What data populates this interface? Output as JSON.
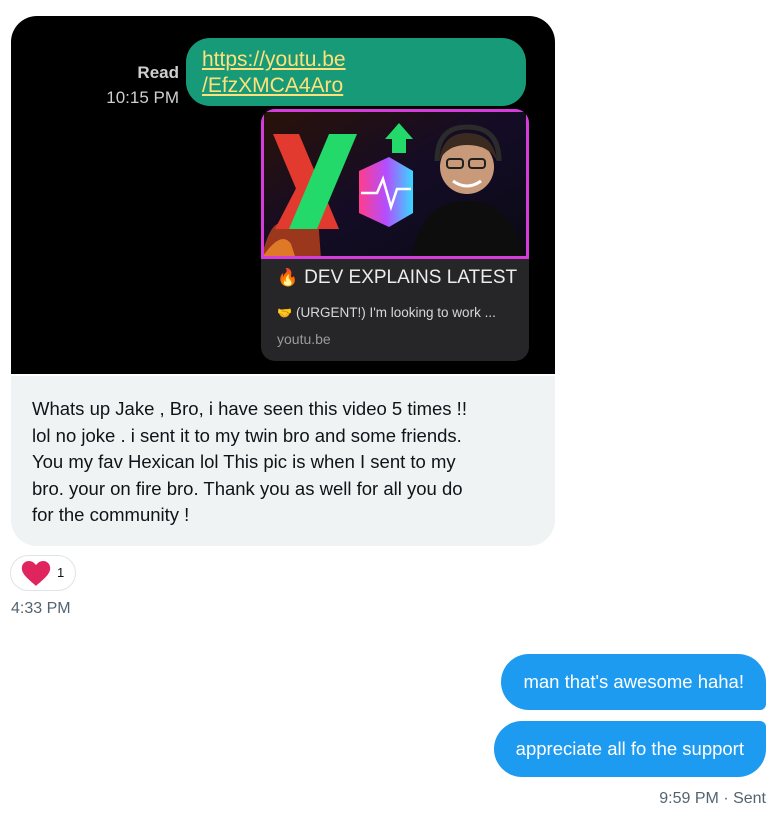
{
  "screenshot": {
    "read_label": "Read",
    "read_time": "10:15 PM",
    "link_line1": "https://youtu.be",
    "link_line2": "/EfzXMCA4Aro",
    "card": {
      "title_icon": "fire-emoji",
      "title": "DEV EXPLAINS LATEST",
      "subtitle_icon": "handshake-emoji",
      "subtitle": "(URGENT!) I'm looking to work ...",
      "domain": "youtu.be"
    }
  },
  "incoming": {
    "lines": [
      "Whats up Jake , Bro, i have seen this video 5 times !!",
      "lol no joke . i sent it to my twin bro and some friends.",
      "You my fav Hexican lol This pic is when I sent to my",
      "bro. your on fire bro. Thank you as well for all you do",
      "for the community !"
    ],
    "reaction_icon": "heart-icon",
    "reaction_count": "1",
    "timestamp": "4:33 PM"
  },
  "outgoing": {
    "messages": [
      "man that's awesome haha!",
      "appreciate all fo the support"
    ],
    "status": "9:59 PM · Sent"
  },
  "colors": {
    "sent_bubble": "#1d9bf0",
    "received_bubble": "#eff3f4",
    "reaction_heart": "#e0245e",
    "screenshot_link_bubble": "#179a78"
  }
}
